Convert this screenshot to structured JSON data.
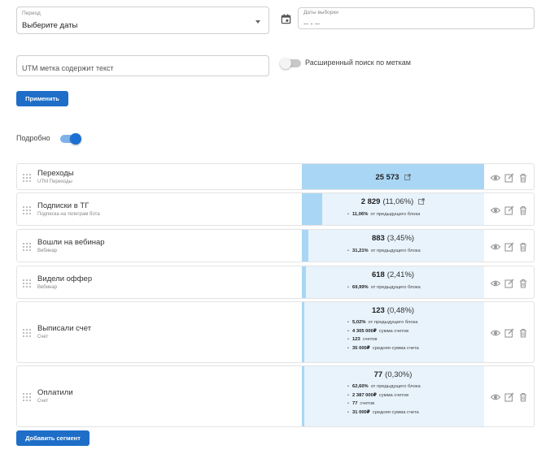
{
  "filters": {
    "period": {
      "label": "Период",
      "value": "Выберите даты"
    },
    "dates": {
      "label": "Даты выборки",
      "value": "-- - --"
    },
    "utm": {
      "placeholder": "UTM метка содержит текст"
    },
    "advanced_search_label": "Расширенный поиск по меткам",
    "advanced_search_enabled": false,
    "apply_label": "Применить"
  },
  "detail": {
    "label": "Подробно",
    "enabled": true
  },
  "accent_color": "#1e6ec8",
  "segments": [
    {
      "title": "Переходы",
      "subtitle": "UTM Переходы",
      "count": "25 573",
      "percent": "",
      "fill": 1.0,
      "bullets": []
    },
    {
      "title": "Подписки в ТГ",
      "subtitle": "Подписка на телеграм бота",
      "count": "2 829",
      "percent": "(11,06%)",
      "fill": 0.11,
      "bullets": [
        {
          "value": "11,06%",
          "text": "от предыдущего блока"
        }
      ]
    },
    {
      "title": "Вошли на вебинар",
      "subtitle": "Вебинар",
      "count": "883",
      "percent": "(3,45%)",
      "fill": 0.035,
      "bullets": [
        {
          "value": "31,21%",
          "text": "от предыдущего блока"
        }
      ]
    },
    {
      "title": "Видели оффер",
      "subtitle": "Вебинар",
      "count": "618",
      "percent": "(2,41%)",
      "fill": 0.024,
      "bullets": [
        {
          "value": "69,99%",
          "text": "от предыдущего блока"
        }
      ]
    },
    {
      "title": "Выписали счет",
      "subtitle": "Счет",
      "count": "123",
      "percent": "(0,48%)",
      "fill": 0.005,
      "bullets": [
        {
          "value": "5,02%",
          "text": "от предыдущего блока"
        },
        {
          "value": "4 305 000₽",
          "text": "сумма счетов"
        },
        {
          "value": "123",
          "text": "счетов"
        },
        {
          "value": "35 000₽",
          "text": "средняя сумма счета"
        }
      ]
    },
    {
      "title": "Оплатили",
      "subtitle": "Счет",
      "count": "77",
      "percent": "(0,30%)",
      "fill": 0.003,
      "bullets": [
        {
          "value": "62,60%",
          "text": "от предыдущего блока"
        },
        {
          "value": "2 387 000₽",
          "text": "сумма счетов"
        },
        {
          "value": "77",
          "text": "счетов"
        },
        {
          "value": "31 000₽",
          "text": "средняя сумма счета"
        }
      ]
    }
  ],
  "add_segment_label": "Добавить сегмент"
}
